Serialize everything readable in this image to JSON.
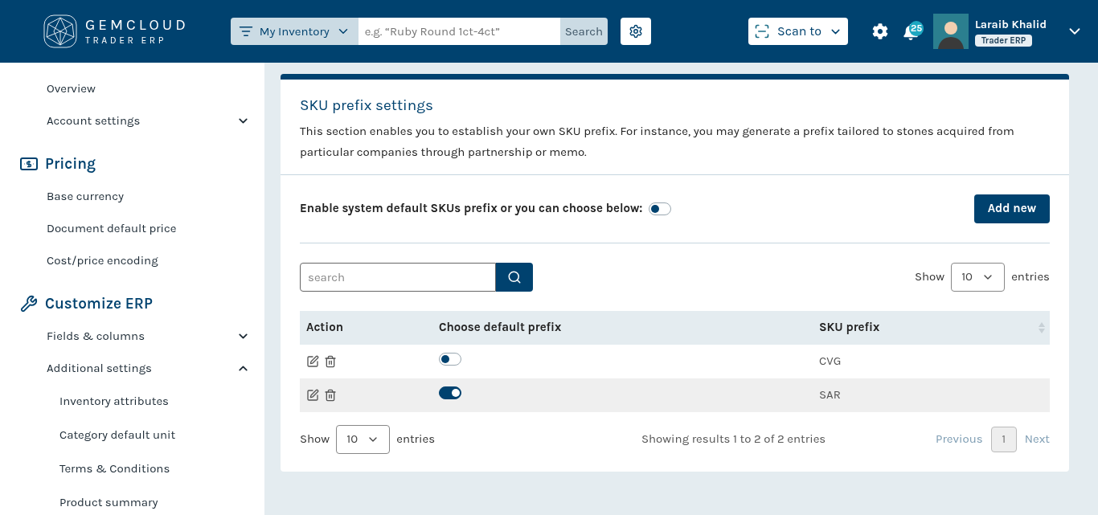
{
  "header": {
    "logo": {
      "name": "GEMCLOUD",
      "tagline": "TRADER ERP"
    },
    "search": {
      "scope": "My Inventory",
      "placeholder": "e.g. “Ruby Round 1ct-4ct”",
      "button": "Search"
    },
    "scan_button": "Scan to",
    "notifications": "25",
    "user": {
      "name": "Laraib Khalid",
      "role": "Trader ERP"
    }
  },
  "sidebar": {
    "top_items": [
      {
        "label": "Overview"
      },
      {
        "label": "Account settings",
        "expanded": false
      }
    ],
    "sections": [
      {
        "kind": "pricing",
        "title": "Pricing",
        "items": [
          {
            "label": "Base currency"
          },
          {
            "label": "Document default price"
          },
          {
            "label": "Cost/price encoding"
          }
        ]
      },
      {
        "kind": "customize",
        "title": "Customize ERP",
        "items": [
          {
            "label": "Fields & columns",
            "expanded": false
          },
          {
            "label": "Additional settings",
            "expanded": true,
            "children": [
              {
                "label": "Inventory attributes"
              },
              {
                "label": "Category default unit"
              },
              {
                "label": "Terms & Conditions"
              },
              {
                "label": "Product summary"
              }
            ]
          }
        ]
      }
    ]
  },
  "card": {
    "title": "SKU prefix settings",
    "description": "This section enables you to establish your own SKU prefix. For instance, you may generate a prefix tailored to stones acquired from particular companies through partnership or memo.",
    "system_default": {
      "label": "Enable system default SKUs prefix or you can choose below:",
      "on": false
    },
    "add_button": "Add new",
    "search": {
      "placeholder": "search"
    },
    "show_top": {
      "label": "Show",
      "value": "10",
      "suffix": "entries"
    },
    "table": {
      "columns": [
        "Action",
        "Choose default prefix",
        "SKU prefix"
      ],
      "rows": [
        {
          "default": false,
          "prefix": "CVG"
        },
        {
          "default": true,
          "prefix": "SAR"
        }
      ]
    },
    "show_bottom": {
      "label": "Show",
      "value": "10",
      "suffix": "entries"
    },
    "summary": "Showing results 1 to 2 of 2 entries",
    "pagination": {
      "previous": "Previous",
      "pages": [
        {
          "label": "1",
          "selected": true
        }
      ],
      "next": "Next"
    }
  }
}
